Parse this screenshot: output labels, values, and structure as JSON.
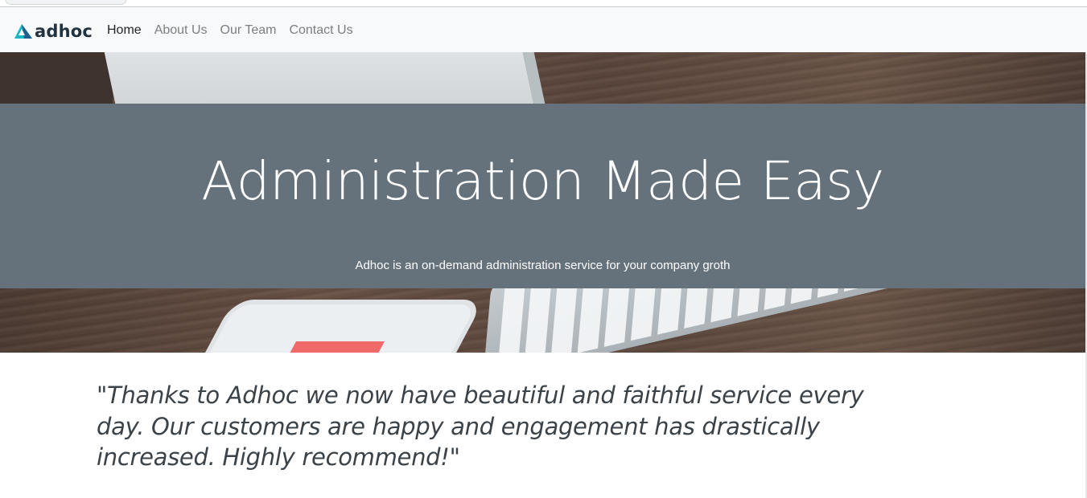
{
  "brand": {
    "name": "adhoc",
    "logo_color_primary": "#16b8c4",
    "logo_color_secondary": "#1f5f8b"
  },
  "nav": {
    "items": [
      {
        "label": "Home",
        "active": true
      },
      {
        "label": "About Us",
        "active": false
      },
      {
        "label": "Our Team",
        "active": false
      },
      {
        "label": "Contact Us",
        "active": false
      }
    ]
  },
  "hero": {
    "title": "Administration Made Easy",
    "subtitle": "Adhoc is an on-demand administration service for your company groth",
    "overlay_color": "#66727b"
  },
  "testimonial": {
    "quote": "\"Thanks to Adhoc we now have beautiful and faithful service every day. Our customers are happy and engagement has drastically increased. Highly recommend!\""
  }
}
